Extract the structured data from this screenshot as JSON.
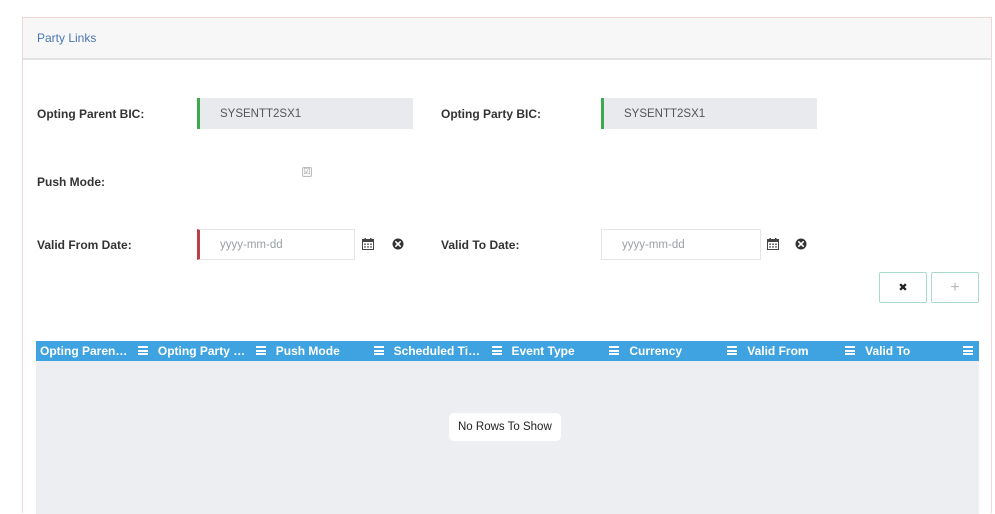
{
  "panel": {
    "title": "Party Links"
  },
  "form": {
    "opting_parent_bic": {
      "label": "Opting Parent BIC:",
      "value": "SYSENTT2SX1"
    },
    "opting_party_bic": {
      "label": "Opting Party BIC:",
      "value": "SYSENTT2SX1"
    },
    "push_mode": {
      "label": "Push Mode:",
      "checked": true,
      "check_glyph": "☑"
    },
    "valid_from_date": {
      "label": "Valid From Date:",
      "placeholder": "yyyy-mm-dd"
    },
    "valid_to_date": {
      "label": "Valid To Date:",
      "placeholder": "yyyy-mm-dd"
    }
  },
  "icons": {
    "calendar": "calendar-icon",
    "clear": "clear-circle-icon",
    "close": "close-icon",
    "plus": "plus-icon",
    "menu": "column-menu-icon"
  },
  "buttons": {
    "cancel_glyph": "✖",
    "add_glyph": "+"
  },
  "grid": {
    "columns": [
      "Opting Paren…",
      "Opting Party …",
      "Push Mode",
      "Scheduled Ti…",
      "Event Type",
      "Currency",
      "Valid From",
      "Valid To"
    ],
    "empty_message": "No Rows To Show"
  },
  "colors": {
    "valid_field_bar": "#3daa50",
    "invalid_field_bar": "#b94046",
    "grid_header": "#3ea3e0",
    "link_title": "#4a77b4"
  }
}
